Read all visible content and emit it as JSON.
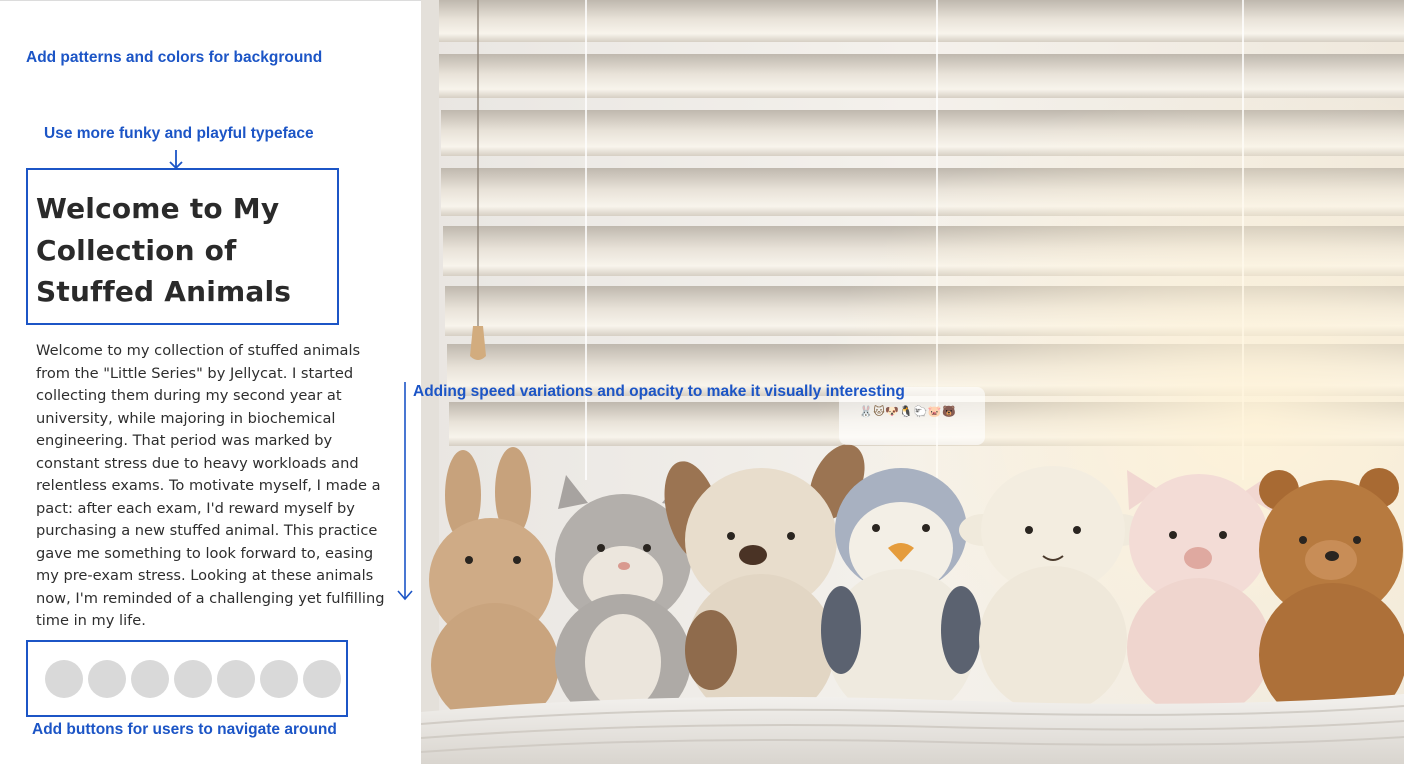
{
  "annotations": {
    "background": "Add patterns and colors for background",
    "typeface": "Use more funky and playful typeface",
    "speed": "Adding speed variations and opacity to make it visually interesting",
    "navigation": "Add buttons for users to navigate around"
  },
  "page": {
    "title": "Welcome to My Collection of Stuffed Animals",
    "intro": "Welcome to my collection of stuffed animals from the \"Little Series\" by Jellycat. I started collecting them during my second year at university, while majoring in biochemical engineering. That period was marked by constant stress due to heavy workloads and relentless exams. To motivate myself, I made a pact: after each exam, I'd reward myself by purchasing a new stuffed animal. This practice gave me something to look forward to, easing my pre-exam stress. Looking at these animals now, I'm reminded of a challenging yet fulfilling time in my life."
  },
  "emoji_strip": "🐰🐱🐶🐧🐑🐷🐻",
  "nav_dot_count": 7,
  "colors": {
    "annotation": "#1c55c6",
    "dot": "#d9d9d9",
    "heading": "#2a2a2a"
  },
  "icons": {
    "annotation_arrows": "arrow-down-icon"
  }
}
